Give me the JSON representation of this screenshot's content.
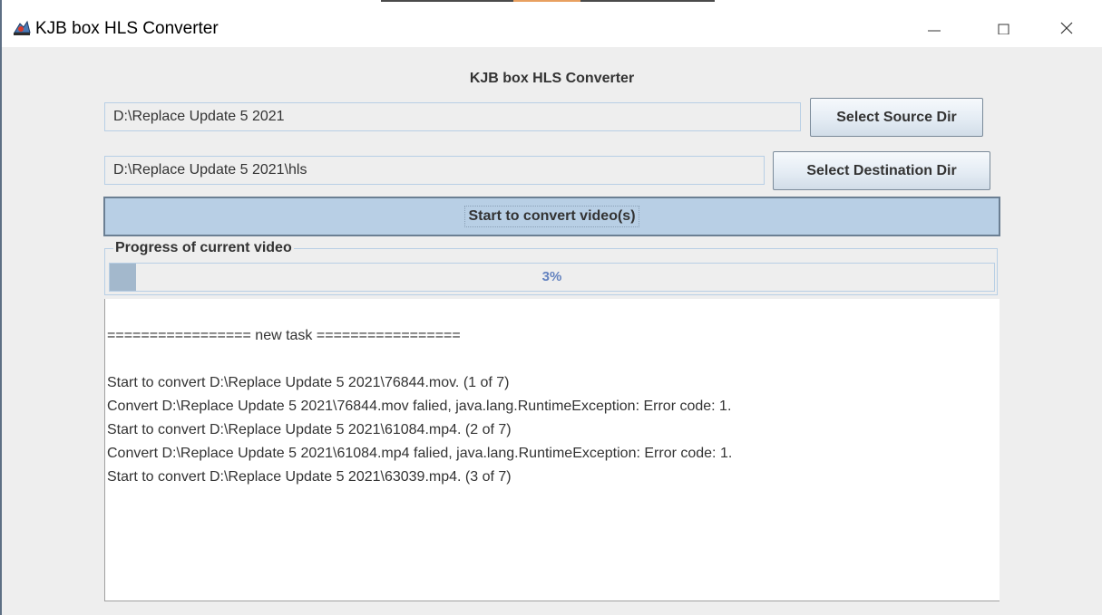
{
  "window": {
    "title": "KJB box HLS Converter",
    "icon": "java-app-icon"
  },
  "app": {
    "heading": "KJB box HLS Converter",
    "source_dir": "D:\\Replace Update 5 2021",
    "destination_dir": "D:\\Replace Update 5 2021\\hls",
    "select_source_label": "Select Source Dir",
    "select_destination_label": "Select Destination Dir",
    "start_label": "Start to convert video(s)"
  },
  "progress": {
    "legend": "Progress of current video",
    "percent": 3,
    "text": "3%"
  },
  "log": {
    "lines": [
      "================= new task =================",
      "",
      "Start to convert D:\\Replace Update 5 2021\\76844.mov. (1 of 7)",
      "Convert D:\\Replace Update 5 2021\\76844.mov falied, java.lang.RuntimeException: Error code: 1.",
      "Start to convert D:\\Replace Update 5 2021\\61084.mp4. (2 of 7)",
      "Convert D:\\Replace Update 5 2021\\61084.mp4 falied, java.lang.RuntimeException: Error code: 1.",
      "Start to convert D:\\Replace Update 5 2021\\63039.mp4. (3 of 7)"
    ]
  },
  "colors": {
    "panel_bg": "#eeeeee",
    "accent_blue": "#b8cfe5",
    "progress_fill": "#a3b8cc",
    "progress_text": "#6382bf"
  }
}
